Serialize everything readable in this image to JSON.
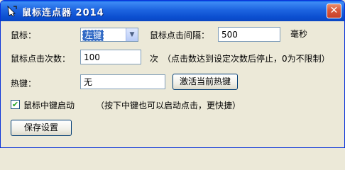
{
  "window": {
    "title": "鼠标连点器 2014",
    "close_glyph": "✕"
  },
  "form": {
    "mouse_button_label": "鼠标：",
    "mouse_button_value": "左键",
    "interval_label": "鼠标点击间隔：",
    "interval_value": "500",
    "interval_unit": "毫秒",
    "count_label": "鼠标点击次数：",
    "count_value": "100",
    "count_unit": "次",
    "count_hint": "（点击数达到设定次数后停止，0为不限制）",
    "hotkey_label": "热键：",
    "hotkey_value": "无",
    "activate_hotkey_button": "激活当前热键",
    "middle_button_check": "✔",
    "middle_button_label": "鼠标中键启动",
    "middle_button_hint": "（按下中键也可以启动点击，更快捷）",
    "save_button": "保存设置"
  },
  "colors": {
    "titlebar": "#0b4fd0",
    "face": "#ece9d8",
    "selection": "#316ac5"
  }
}
